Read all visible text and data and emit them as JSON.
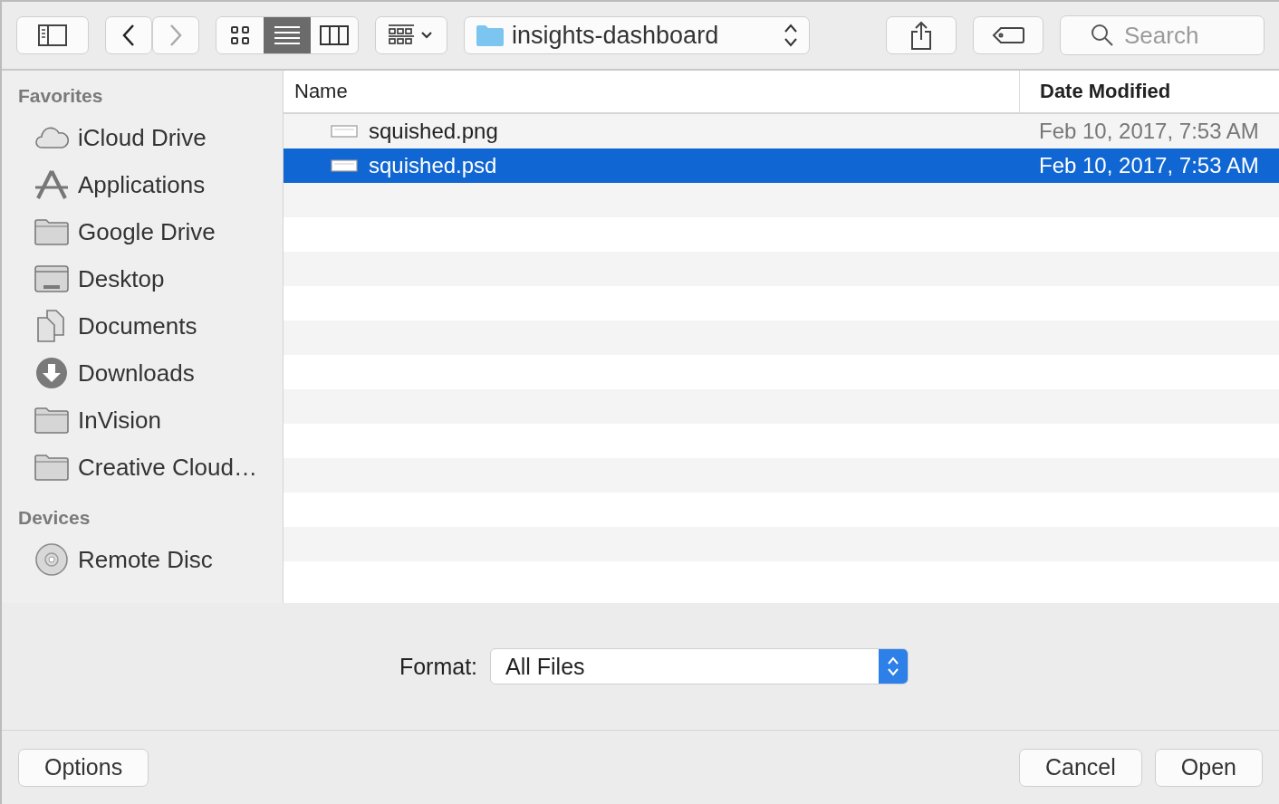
{
  "toolbar": {
    "view_modes": [
      {
        "kind": "icons",
        "selected": false
      },
      {
        "kind": "list",
        "selected": true
      },
      {
        "kind": "columns",
        "selected": false
      }
    ],
    "location": "insights-dashboard",
    "search": {
      "placeholder": "Search"
    }
  },
  "sidebar": {
    "sections": [
      {
        "title": "Favorites",
        "items": [
          {
            "label": "iCloud Drive",
            "kind": "cloud"
          },
          {
            "label": "Applications",
            "kind": "apps"
          },
          {
            "label": "Google Drive",
            "kind": "folder"
          },
          {
            "label": "Desktop",
            "kind": "desktop"
          },
          {
            "label": "Documents",
            "kind": "documents"
          },
          {
            "label": "Downloads",
            "kind": "downloads"
          },
          {
            "label": "InVision",
            "kind": "folder"
          },
          {
            "label": "Creative Cloud…",
            "kind": "folder"
          }
        ]
      },
      {
        "title": "Devices",
        "items": [
          {
            "label": "Remote Disc",
            "kind": "disc"
          }
        ]
      }
    ]
  },
  "table": {
    "columns": [
      "Name",
      "Date Modified"
    ],
    "rows": [
      {
        "name": "squished.png",
        "date": "Feb 10, 2017, 7:53 AM",
        "selected": false
      },
      {
        "name": "squished.psd",
        "date": "Feb 10, 2017, 7:53 AM",
        "selected": true
      }
    ]
  },
  "format": {
    "label": "Format:",
    "value": "All Files"
  },
  "buttons": {
    "options": "Options",
    "cancel": "Cancel",
    "open": "Open"
  }
}
